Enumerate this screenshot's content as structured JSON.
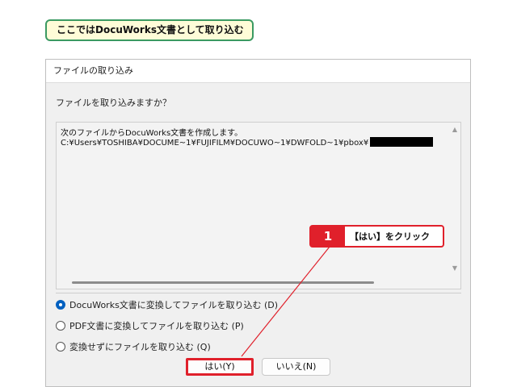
{
  "caption": {
    "text": "ここではDocuWorks文書として取り込む"
  },
  "dialog": {
    "title": "ファイルの取り込み",
    "question": "ファイルを取り込みますか？",
    "textbox": {
      "line1": "次のファイルからDocuWorks文書を作成します。",
      "line2": "C:¥Users¥TOSHIBA¥DOCUME~1¥FUJIFILM¥DOCUWO~1¥DWFOLD~1¥pbox¥"
    },
    "options": [
      {
        "label": "DocuWorks文書に変換してファイルを取り込む (D)",
        "checked": true
      },
      {
        "label": "PDF文書に変換してファイルを取り込む (P)",
        "checked": false
      },
      {
        "label": "変換せずにファイルを取り込む (Q)",
        "checked": false
      }
    ],
    "buttons": {
      "yes": "はい(Y)",
      "no": "いいえ(N)"
    }
  },
  "callout": {
    "number": "1",
    "text": "【はい】をクリック"
  },
  "colors": {
    "highlight_red": "#e0202b",
    "caption_border": "#3b9a62",
    "caption_bg": "#fefcd8",
    "radio_selected": "#0060c0"
  }
}
